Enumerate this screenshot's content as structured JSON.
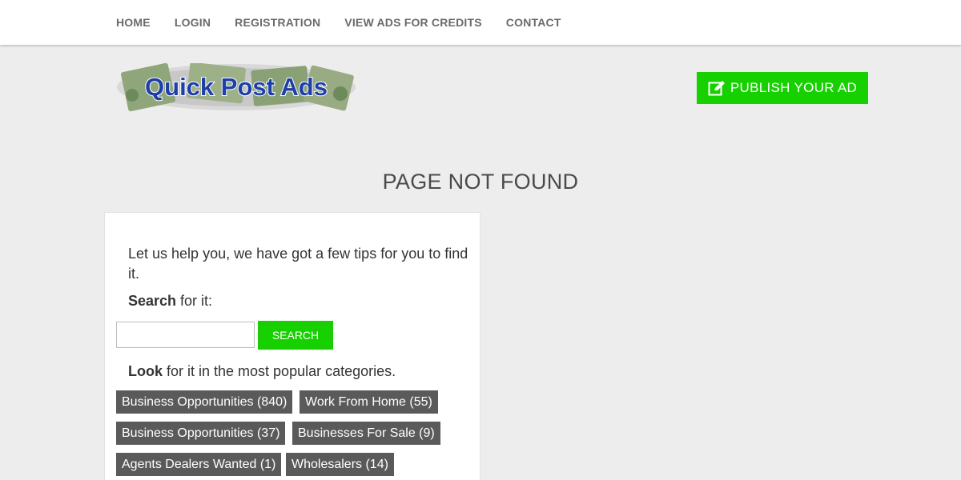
{
  "nav": {
    "items": [
      "HOME",
      "LOGIN",
      "REGISTRATION",
      "VIEW ADS FOR CREDITS",
      "CONTACT"
    ]
  },
  "logo": {
    "text": "Quick Post Ads"
  },
  "publish_button": {
    "label": "PUBLISH YOUR AD",
    "icon": "edit-icon"
  },
  "page_title": "PAGE NOT FOUND",
  "help": {
    "intro": "Let us help you, we have got a few tips for you to find it.",
    "search_bold": "Search",
    "search_rest": " for it:",
    "search_button": "SEARCH",
    "search_value": "",
    "look_bold": "Look",
    "look_rest": " for it in the most popular categories."
  },
  "categories": [
    "Business Opportunities (840)",
    "Work From Home (55)",
    "Business Opportunities (37)",
    "Businesses For Sale (9)",
    "Agents Dealers Wanted (1)",
    "Wholesalers (14)"
  ],
  "colors": {
    "accent": "#16d000",
    "tag_bg": "#5a5a5a",
    "background": "#ededed"
  }
}
